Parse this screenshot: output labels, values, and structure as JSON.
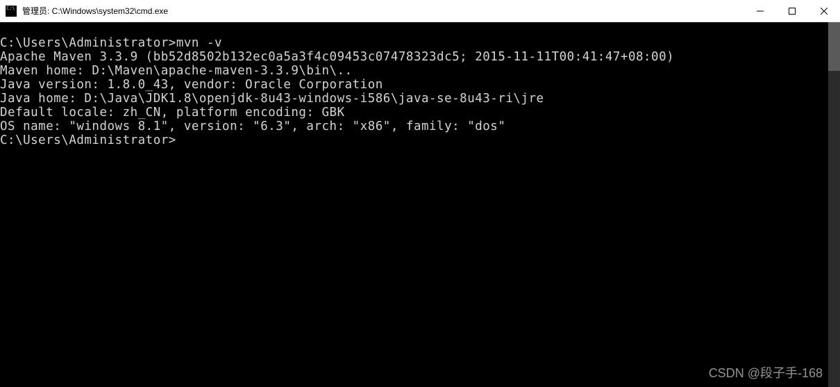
{
  "titlebar": {
    "title": "管理员: C:\\Windows\\system32\\cmd.exe"
  },
  "terminal": {
    "lines": [
      "C:\\Users\\Administrator>mvn -v",
      "Apache Maven 3.3.9 (bb52d8502b132ec0a5a3f4c09453c07478323dc5; 2015-11-11T00:41:47+08:00)",
      "Maven home: D:\\Maven\\apache-maven-3.3.9\\bin\\..",
      "Java version: 1.8.0_43, vendor: Oracle Corporation",
      "Java home: D:\\Java\\JDK1.8\\openjdk-8u43-windows-i586\\java-se-8u43-ri\\jre",
      "Default locale: zh_CN, platform encoding: GBK",
      "OS name: \"windows 8.1\", version: \"6.3\", arch: \"x86\", family: \"dos\"",
      "",
      "C:\\Users\\Administrator>"
    ]
  },
  "watermark": "CSDN @段子手-168"
}
